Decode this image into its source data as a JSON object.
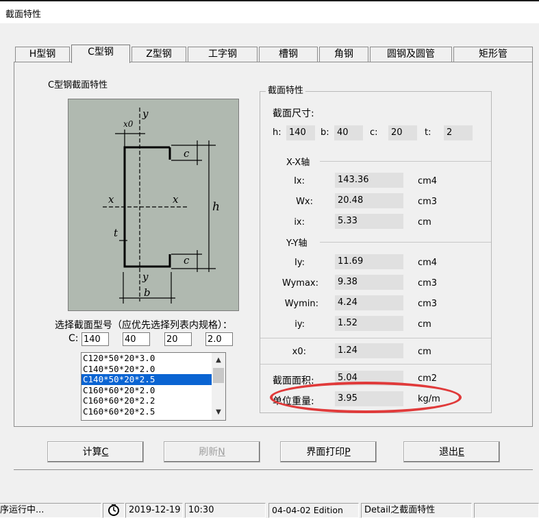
{
  "window": {
    "title": "截面特性"
  },
  "tabs": [
    {
      "label": "H型钢",
      "active": false
    },
    {
      "label": "C型钢",
      "active": true
    },
    {
      "label": "Z型钢",
      "active": false
    },
    {
      "label": "工字钢",
      "active": false
    },
    {
      "label": "槽钢",
      "active": false
    },
    {
      "label": "角钢",
      "active": false
    },
    {
      "label": "圆钢及圆管",
      "active": false
    },
    {
      "label": "矩形管",
      "active": false
    }
  ],
  "left_group": {
    "title": "C型钢截面特性"
  },
  "diagram": {
    "labels": {
      "y_top": "y",
      "x0": "x0",
      "c_top": "c",
      "x_left": "x",
      "x_right": "x",
      "h": "h",
      "t": "t",
      "c_bottom": "c",
      "y_bottom": "y",
      "b": "b"
    }
  },
  "select": {
    "label": "选择截面型号（应优先选择列表内规格）：",
    "c_label": "C:",
    "inputs": {
      "h": "140",
      "b": "40",
      "c": "20",
      "t": "2.0"
    }
  },
  "list": {
    "items": [
      "C120*50*20*3.0",
      "C140*50*20*2.0",
      "C140*50*20*2.5",
      "C160*60*20*2.0",
      "C160*60*20*2.2",
      "C160*60*20*2.5"
    ],
    "selected_index": 2
  },
  "props": {
    "group_title": "截面特性",
    "dims_title": "截面尺寸:",
    "dims": [
      {
        "label": "h:",
        "value": "140"
      },
      {
        "label": "b:",
        "value": "40"
      },
      {
        "label": "c:",
        "value": "20"
      },
      {
        "label": "t:",
        "value": "2"
      }
    ],
    "xx_title": "X-X轴",
    "xx": [
      {
        "label": "Ix:",
        "value": "143.36",
        "unit": "cm4"
      },
      {
        "label": "Wx:",
        "value": "20.48",
        "unit": "cm3"
      },
      {
        "label": "ix:",
        "value": "5.33",
        "unit": "cm"
      }
    ],
    "yy_title": "Y-Y轴",
    "yy": [
      {
        "label": "Iy:",
        "value": "11.69",
        "unit": "cm4"
      },
      {
        "label": "Wymax:",
        "value": "9.38",
        "unit": "cm3"
      },
      {
        "label": "Wymin:",
        "value": "4.24",
        "unit": "cm3"
      },
      {
        "label": "iy:",
        "value": "1.52",
        "unit": "cm"
      }
    ],
    "x0": {
      "label": "x0:",
      "value": "1.24",
      "unit": "cm"
    },
    "area": {
      "label": "截面面积:",
      "value": "5.04",
      "unit": "cm2"
    },
    "weight": {
      "label": "单位重量:",
      "value": "3.95",
      "unit": "kg/m"
    }
  },
  "buttons": {
    "calc": {
      "label": "计算",
      "key": "C"
    },
    "refresh": {
      "label": "刷新",
      "key": "N"
    },
    "print": {
      "label": "界面打印",
      "key": "P"
    },
    "exit": {
      "label": "退出",
      "key": "E"
    }
  },
  "statusbar": {
    "status": "序运行中...",
    "date": "2019-12-19",
    "time": "10:30",
    "edition": "04-04-02 Edition",
    "module": "Detail之截面特性"
  },
  "colors": {
    "highlight_ring": "#e03a3a",
    "selection": "#0a64d2",
    "diagram_bg": "#b0b9b0"
  }
}
